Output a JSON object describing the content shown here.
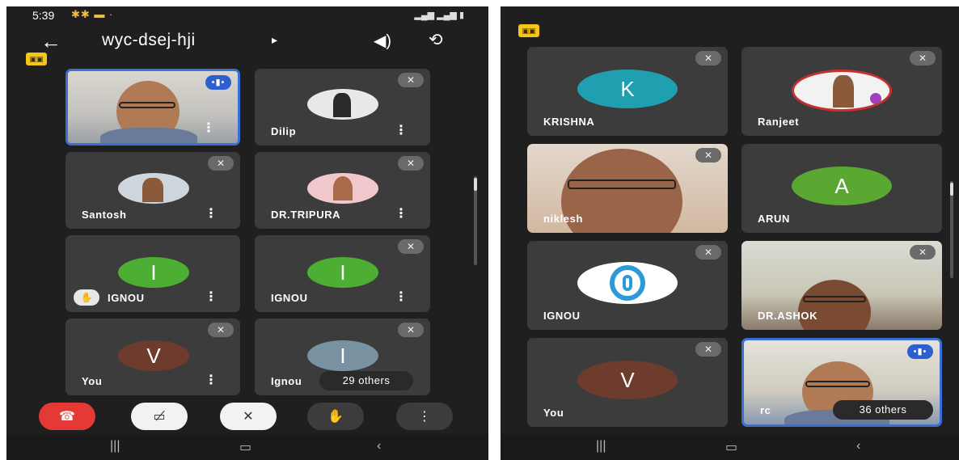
{
  "left_screen": {
    "status_time": "5:39",
    "meeting_title": "wyc-dsej-hji",
    "tiles": [
      {
        "name": "",
        "initial": ""
      },
      {
        "name": "Dilip",
        "initial": ""
      },
      {
        "name": "Santosh",
        "initial": ""
      },
      {
        "name": "DR.TRIPURA",
        "initial": ""
      },
      {
        "name": "IGNOU",
        "initial": "I",
        "color": "#4caf34"
      },
      {
        "name": "IGNOU",
        "initial": "I",
        "color": "#4caf34"
      },
      {
        "name": "You",
        "initial": "V",
        "color": "#6d3c2c"
      },
      {
        "name": "Ignou",
        "initial": "I",
        "color": "#7892a2"
      }
    ],
    "others_label": "29 others"
  },
  "right_screen": {
    "tiles": [
      {
        "name": "KRISHNA",
        "initial": "K",
        "color": "#1f9fb0"
      },
      {
        "name": "Ranjeet",
        "initial": ""
      },
      {
        "name": "niklesh",
        "initial": ""
      },
      {
        "name": "ARUN",
        "initial": "A",
        "color": "#5aa832"
      },
      {
        "name": "IGNOU",
        "initial": ""
      },
      {
        "name": "DR.ASHOK",
        "initial": ""
      },
      {
        "name": "You",
        "initial": "V",
        "color": "#6d3c2c"
      },
      {
        "name": "rc",
        "initial": ""
      }
    ],
    "others_label": "36 others"
  },
  "colors": {
    "end_call": "#e53935",
    "accent_blue": "#2d5fd0"
  }
}
